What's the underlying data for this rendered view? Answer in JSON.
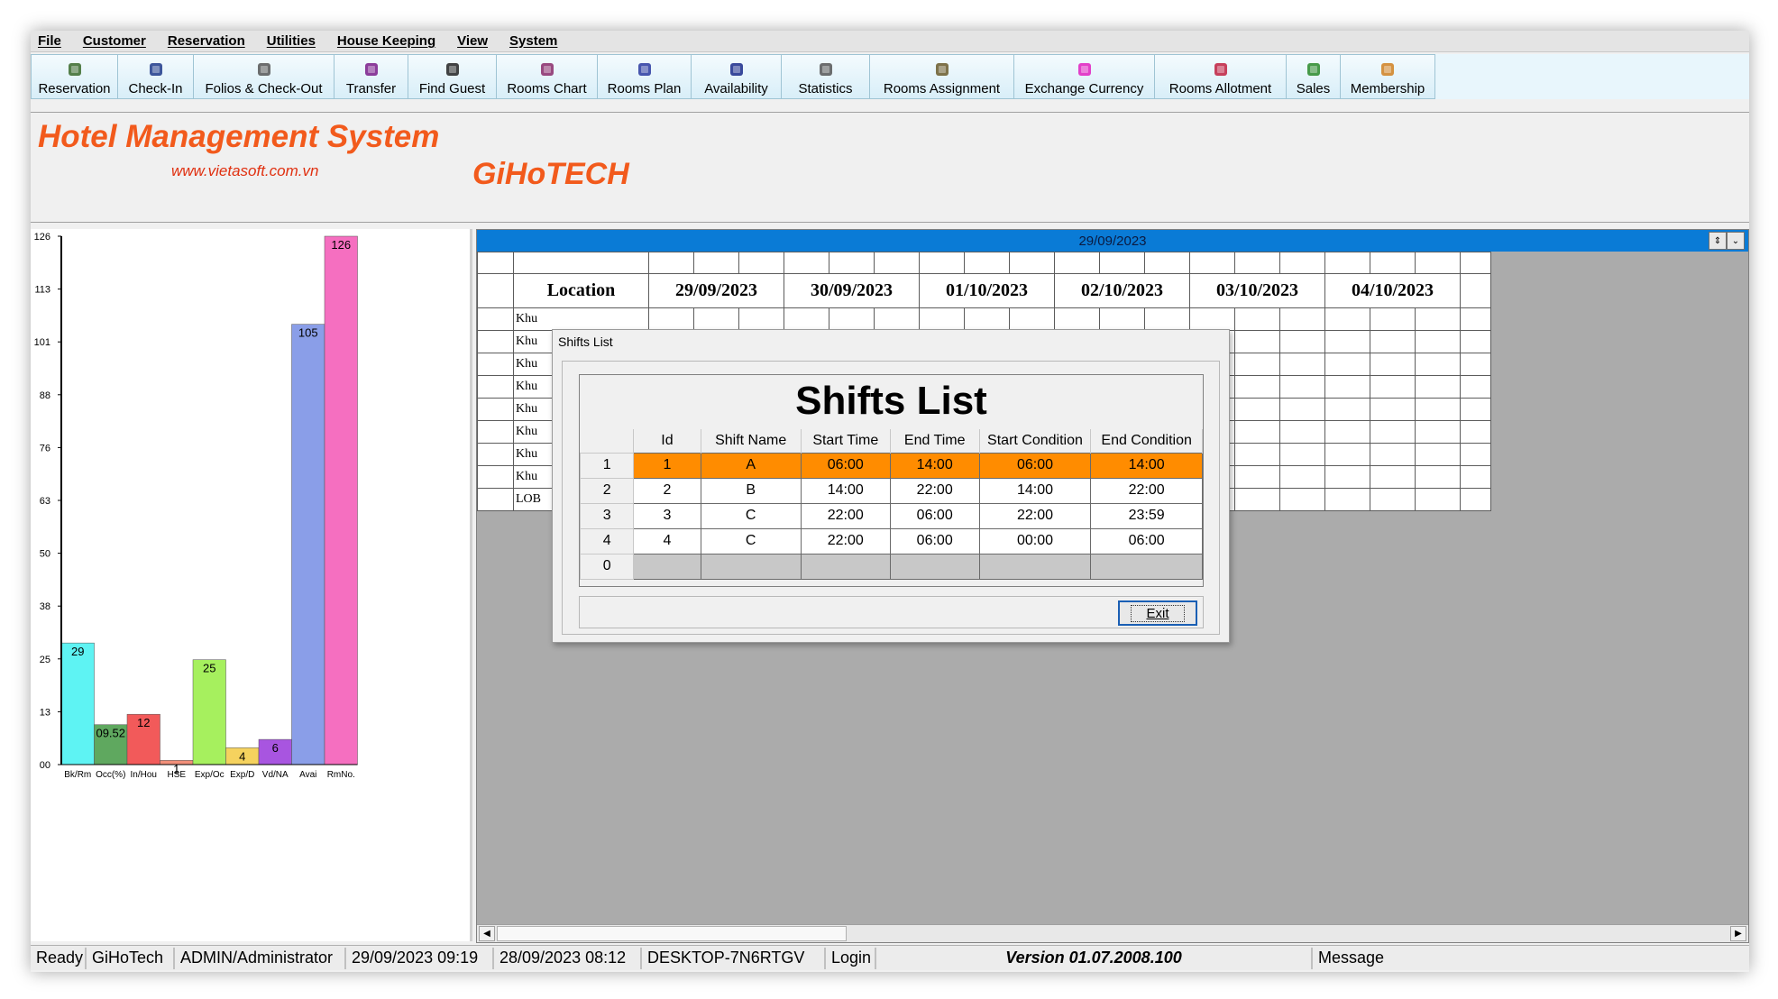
{
  "menu": [
    "File",
    "Customer",
    "Reservation",
    "Utilities",
    "House Keeping",
    "View",
    "System"
  ],
  "toolbar": [
    {
      "label": "Reservation",
      "icon": "pen-icon",
      "color": "#3a6a2a"
    },
    {
      "label": "Check-In",
      "icon": "people-icon",
      "color": "#1e3a8a"
    },
    {
      "label": "Folios & Check-Out",
      "icon": "globe-icon",
      "color": "#555555"
    },
    {
      "label": "Transfer",
      "icon": "transfer-icon",
      "color": "#7a1c8a"
    },
    {
      "label": "Find Guest",
      "icon": "binoculars-icon",
      "color": "#222222"
    },
    {
      "label": "Rooms Chart",
      "icon": "rooms-chart-icon",
      "color": "#8a2a6a"
    },
    {
      "label": "Rooms Plan",
      "icon": "rooms-plan-icon",
      "color": "#2a3aa0"
    },
    {
      "label": "Availability",
      "icon": "availability-icon",
      "color": "#1a2a8a"
    },
    {
      "label": "Statistics",
      "icon": "statistics-icon",
      "color": "#555555"
    },
    {
      "label": "Rooms Assignment",
      "icon": "rooms-assignment-icon",
      "color": "#6a5a2a"
    },
    {
      "label": "Exchange Currency",
      "icon": "currency-icon",
      "color": "#e020c0"
    },
    {
      "label": "Rooms Allotment",
      "icon": "lock-icon",
      "color": "#c02040"
    },
    {
      "label": "Sales",
      "icon": "sales-icon",
      "color": "#2a8a2a"
    },
    {
      "label": "Membership",
      "icon": "membership-icon",
      "color": "#d08020"
    }
  ],
  "brand": {
    "title": "Hotel Management System",
    "url": "www.vietasoft.com.vn",
    "company": "GiHoTECH"
  },
  "chart_data": {
    "type": "bar",
    "categories": [
      "Bk/Rm",
      "Occ(%)",
      "In/Hou",
      "HSE",
      "Exp/Oc",
      "Exp/D",
      "Vd/NA",
      "Avai",
      "RmNo."
    ],
    "values": [
      29,
      9.52,
      12,
      1,
      25,
      4,
      6,
      105,
      126
    ],
    "value_labels": [
      "29",
      "09.52",
      "12",
      "1",
      "25",
      "4",
      "6",
      "105",
      "126"
    ],
    "colors": [
      "#5ef3f3",
      "#5fa85f",
      "#f25a5a",
      "#f2907a",
      "#a6f05e",
      "#f5d25e",
      "#a855e0",
      "#8a9ee8",
      "#f56fc0"
    ],
    "yticks": [
      "00",
      "13",
      "25",
      "38",
      "50",
      "63",
      "76",
      "88",
      "101",
      "113",
      "126"
    ],
    "ylim": [
      0,
      126
    ]
  },
  "room_plan": {
    "current_date": "29/09/2023",
    "location_header": "Location",
    "dates": [
      "29/09/2023",
      "30/09/2023",
      "01/10/2023",
      "02/10/2023",
      "03/10/2023",
      "04/10/2023"
    ],
    "locations": [
      "Khu",
      "Khu",
      "Khu",
      "Khu",
      "Khu",
      "Khu",
      "Khu",
      "Khu",
      "LOB"
    ]
  },
  "dialog": {
    "window_title": "Shifts List",
    "heading": "Shifts List",
    "columns": [
      "Id",
      "Shift Name",
      "Start Time",
      "End Time",
      "Start Condition",
      "End Condition"
    ],
    "rows": [
      {
        "num": "1",
        "cells": [
          "1",
          "A",
          "06:00",
          "14:00",
          "06:00",
          "14:00"
        ]
      },
      {
        "num": "2",
        "cells": [
          "2",
          "B",
          "14:00",
          "22:00",
          "14:00",
          "22:00"
        ]
      },
      {
        "num": "3",
        "cells": [
          "3",
          "C",
          "22:00",
          "06:00",
          "22:00",
          "23:59"
        ]
      },
      {
        "num": "4",
        "cells": [
          "4",
          "C",
          "22:00",
          "06:00",
          "00:00",
          "06:00"
        ]
      },
      {
        "num": "0",
        "cells": [
          "",
          "",
          "",
          "",
          "",
          ""
        ]
      }
    ],
    "selected_row": 0,
    "selected_color": "#ff8c00",
    "exit_label": "Exit"
  },
  "status": {
    "ready": "Ready",
    "company": "GiHoTech",
    "user": "ADMIN/Administrator",
    "current_time": "29/09/2023 09:19",
    "login_time": "28/09/2023 08:12",
    "machine": "DESKTOP-7N6RTGV",
    "mode": "Login",
    "version": "Version 01.07.2008.100",
    "message": "Message"
  }
}
